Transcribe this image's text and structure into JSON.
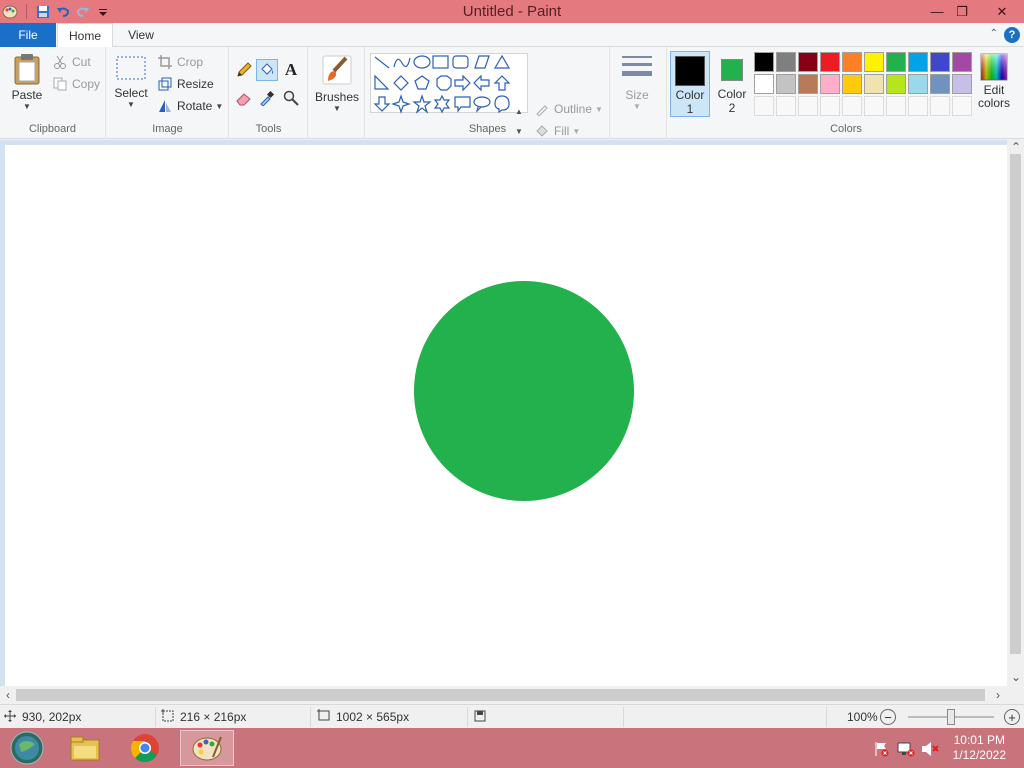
{
  "window": {
    "title": "Untitled - Paint",
    "minimize_glyph": "—",
    "maximize_glyph": "❐",
    "close_glyph": "✕"
  },
  "tabs": {
    "file": "File",
    "home": "Home",
    "view": "View",
    "help_glyph": "?",
    "collapse_glyph": "⌃"
  },
  "ribbon": {
    "clipboard": {
      "label": "Clipboard",
      "paste": "Paste",
      "cut": "Cut",
      "copy": "Copy"
    },
    "image": {
      "label": "Image",
      "select": "Select",
      "crop": "Crop",
      "resize": "Resize",
      "rotate": "Rotate"
    },
    "tools": {
      "label": "Tools",
      "text_glyph": "A"
    },
    "brushes": {
      "label": "Brushes"
    },
    "shapes": {
      "label": "Shapes",
      "outline": "Outline",
      "fill": "Fill"
    },
    "size": {
      "label": "Size"
    },
    "colors": {
      "label": "Colors",
      "color1": "Color",
      "color1_num": "1",
      "color2": "Color",
      "color2_num": "2",
      "edit": "Edit",
      "edit2": "colors",
      "color1_value": "#000000",
      "color2_value": "#22b14c",
      "palette_row1": [
        "#000000",
        "#7f7f7f",
        "#880015",
        "#ed1c24",
        "#ff7f27",
        "#fff200",
        "#22b14c",
        "#00a2e8",
        "#3f48cc",
        "#a349a4"
      ],
      "palette_row2": [
        "#ffffff",
        "#c3c3c3",
        "#b97a57",
        "#ffaec9",
        "#ffc90e",
        "#efe4b0",
        "#b5e61d",
        "#99d9ea",
        "#7092be",
        "#c8bfe7"
      ]
    }
  },
  "canvas": {
    "shape": "circle",
    "fill_color": "#22b14c"
  },
  "status": {
    "cursor_pos": "930, 202px",
    "selection_size": "216 × 216px",
    "canvas_size": "1002 × 565px",
    "zoom": "100%",
    "zoom_out": "−",
    "zoom_in": "+",
    "zoom_level": 1.0
  },
  "taskbar": {
    "time": "10:01 PM",
    "date": "1/12/2022"
  }
}
